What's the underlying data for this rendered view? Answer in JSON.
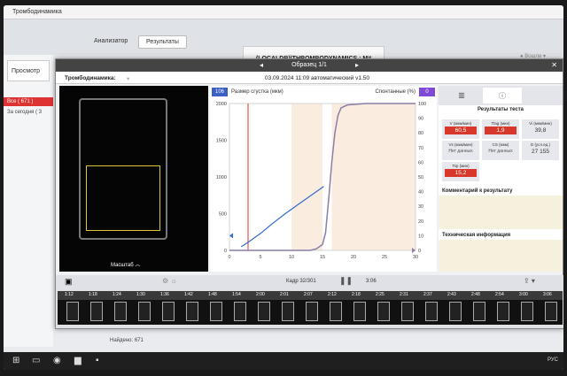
{
  "app": {
    "title": "Тромбодинамика"
  },
  "main_tabs": {
    "analyzer": "Анализатор",
    "results": "Результаты"
  },
  "db_label": "(LOCALDB)\\THROMBODYNAMICS : M#",
  "left": {
    "view_btn": "Просмотр",
    "all": "Все ( 671 )",
    "today": "За сегодня ( 3"
  },
  "dialog": {
    "header": "Образец 1/1",
    "subtitle_label": "Тромбодинамика:",
    "datetime": "03.09.2024 11:09 автоматический v1.50",
    "scale_label": "Масштаб"
  },
  "chart_top": {
    "left_badge": "106",
    "size_label": "Размер сгустка (мкм)",
    "spont_label": "Спонтанные (%)",
    "right_badge": "0"
  },
  "results": {
    "title": "Результаты теста",
    "cells": [
      {
        "label": "V (мкм/мин)",
        "value": "60,5",
        "style": "red"
      },
      {
        "label": "Tlag (мин)",
        "value": "1,9",
        "style": "red"
      },
      {
        "label": "Vi (мкм/мин)",
        "value": "39,8",
        "style": "plain"
      },
      {
        "label": "Vs (мкм/мин)",
        "value": "Нет данных",
        "style": "na"
      },
      {
        "label": "CS (мкм)",
        "value": "Нет данных",
        "style": "na"
      },
      {
        "label": "D (усл.ед.)",
        "value": "27 155",
        "style": "plain"
      },
      {
        "label": "Tsp (мин)",
        "value": "15,2",
        "style": "red"
      }
    ],
    "comment_label": "Комментарий к результату",
    "tech_label": "Техническая информация"
  },
  "timeline": {
    "frame": "Кадр 32/301",
    "time": "3:06",
    "ticks": [
      "1:12",
      "1:18",
      "1:24",
      "1:30",
      "1:36",
      "1:42",
      "1:48",
      "1:54",
      "2:00",
      "2:01",
      "2:07",
      "2:12",
      "2:18",
      "2:25",
      "2:31",
      "2:37",
      "2:43",
      "2:48",
      "2:54",
      "3:00",
      "3:06"
    ]
  },
  "footer": {
    "found": "Найдено: 671"
  },
  "taskbar": {
    "lang": "РУС"
  },
  "colors": {
    "accent_red": "#d8382b",
    "curve_blue": "#2f6bd0",
    "curve_purple": "#8a7fa8",
    "highlight": "#f7e1c9"
  },
  "chart_data": {
    "type": "line",
    "xlabel": "",
    "ylabel": "Размер сгустка (мкм)",
    "y2label": "Спонтанные (%)",
    "xlim": [
      0,
      30
    ],
    "ylim": [
      0,
      2000
    ],
    "y2lim": [
      0,
      100
    ],
    "xticks": [
      0,
      5,
      10,
      15,
      20,
      25,
      30
    ],
    "yticks": [
      0,
      500,
      1000,
      1500,
      2000
    ],
    "y2ticks": [
      0,
      10,
      20,
      30,
      40,
      50,
      60,
      70,
      80,
      90,
      100
    ],
    "series": [
      {
        "axis": "y",
        "x": [
          1.9,
          3,
          5,
          7,
          9,
          11,
          13,
          15.2
        ],
        "y": [
          50,
          110,
          230,
          370,
          500,
          620,
          740,
          870
        ]
      },
      {
        "axis": "y2",
        "x": [
          0,
          13,
          14,
          15,
          15.5,
          16,
          16.5,
          17,
          17.5,
          18,
          19,
          22,
          30
        ],
        "y": [
          0,
          0,
          1,
          4,
          12,
          35,
          60,
          80,
          92,
          97,
          99,
          100,
          100
        ]
      }
    ],
    "tlag_marker": 3,
    "highlight_ranges": [
      [
        10,
        15
      ],
      [
        16.5,
        30
      ]
    ]
  }
}
